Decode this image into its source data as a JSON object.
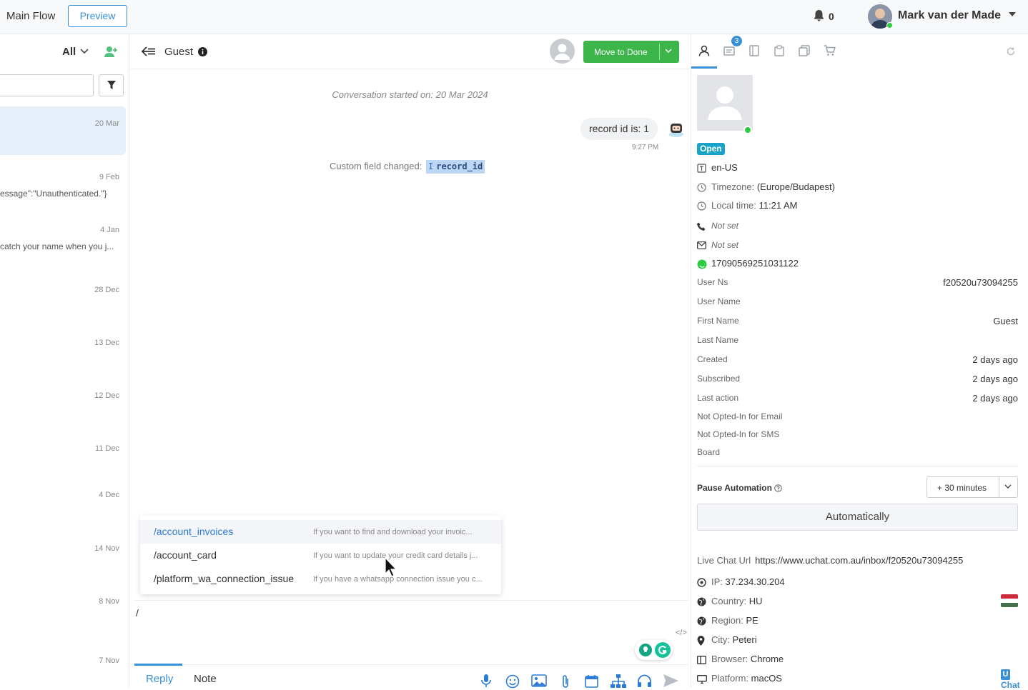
{
  "topbar": {
    "flow_title": "Main Flow",
    "preview_label": "Preview",
    "notification_count": "0",
    "user_name": "Mark van der Made"
  },
  "left": {
    "filter_label": "All",
    "search_placeholder": "",
    "conversations": [
      {
        "date": "20 Mar",
        "snippet": ""
      },
      {
        "date": "9 Feb",
        "snippet": "essage\":\"Unauthenticated.\"}"
      },
      {
        "date": "4 Jan",
        "snippet": "catch your name when you j..."
      },
      {
        "date": "28 Dec",
        "snippet": ""
      },
      {
        "date": "13 Dec",
        "snippet": ""
      },
      {
        "date": "12 Dec",
        "snippet": ""
      },
      {
        "date": "11 Dec",
        "snippet": ""
      },
      {
        "date": "4 Dec",
        "snippet": ""
      },
      {
        "date": "14 Nov",
        "snippet": ""
      },
      {
        "date": "8 Nov",
        "snippet": ""
      },
      {
        "date": "7 Nov",
        "snippet": ""
      }
    ]
  },
  "chat": {
    "contact_name": "Guest",
    "move_to_done_label": "Move to Done",
    "conversation_started": "Conversation started on: 20 Mar 2024",
    "message_text": "record id is: 1",
    "message_time": "9:27 PM",
    "custom_field_changed_label": "Custom field changed:",
    "custom_field_name": "record_id",
    "suggestions": [
      {
        "command": "/account_invoices",
        "description": "If you want to find and download your invoic..."
      },
      {
        "command": "/account_card",
        "description": "If you want to update your credit card details j..."
      },
      {
        "command": "/platform_wa_connection_issue",
        "description": "If you have a whatsapp connection issue you c..."
      }
    ],
    "composer_value": "/",
    "code_toggle": "</>",
    "tab_reply": "Reply",
    "tab_note": "Note"
  },
  "right": {
    "tab_badge": "3",
    "status_badge": "Open",
    "language": "en-US",
    "timezone_label": "Timezone:",
    "timezone_value": "(Europe/Budapest)",
    "local_time_label": "Local time:",
    "local_time_value": "11:21 AM",
    "phone": "Not set",
    "email": "Not set",
    "whatsapp_id": "17090569251031122",
    "fields": [
      {
        "label": "User Ns",
        "value": "f20520u73094255"
      },
      {
        "label": "User Name",
        "value": ""
      },
      {
        "label": "First Name",
        "value": "Guest"
      },
      {
        "label": "Last Name",
        "value": ""
      },
      {
        "label": "Created",
        "value": "2 days ago"
      },
      {
        "label": "Subscribed",
        "value": "2 days ago"
      },
      {
        "label": "Last action",
        "value": "2 days ago"
      },
      {
        "label": "Not Opted-In for Email",
        "value": ""
      },
      {
        "label": "Not Opted-In for SMS",
        "value": ""
      },
      {
        "label": "Board",
        "value": ""
      }
    ],
    "pause_automation_label": "Pause Automation",
    "pause_value": "+ 30 minutes",
    "automatically_label": "Automatically",
    "live_chat_url_label": "Live Chat Url",
    "live_chat_url": "https://www.uchat.com.au/inbox/f20520u73094255",
    "ip_label": "IP:",
    "ip_value": "37.234.30.204",
    "country_label": "Country:",
    "country_value": "HU",
    "region_label": "Region:",
    "region_value": "PE",
    "city_label": "City:",
    "city_value": "Peteri",
    "browser_label": "Browser:",
    "browser_value": "Chrome",
    "platform_label": "Platform:",
    "platform_value": "macOS"
  },
  "widget": {
    "badge_letter": "U",
    "label": "Chat"
  },
  "colors": {
    "accent": "#3b8fd6",
    "success": "#3cb64b",
    "status_open": "#1aa3c9"
  }
}
